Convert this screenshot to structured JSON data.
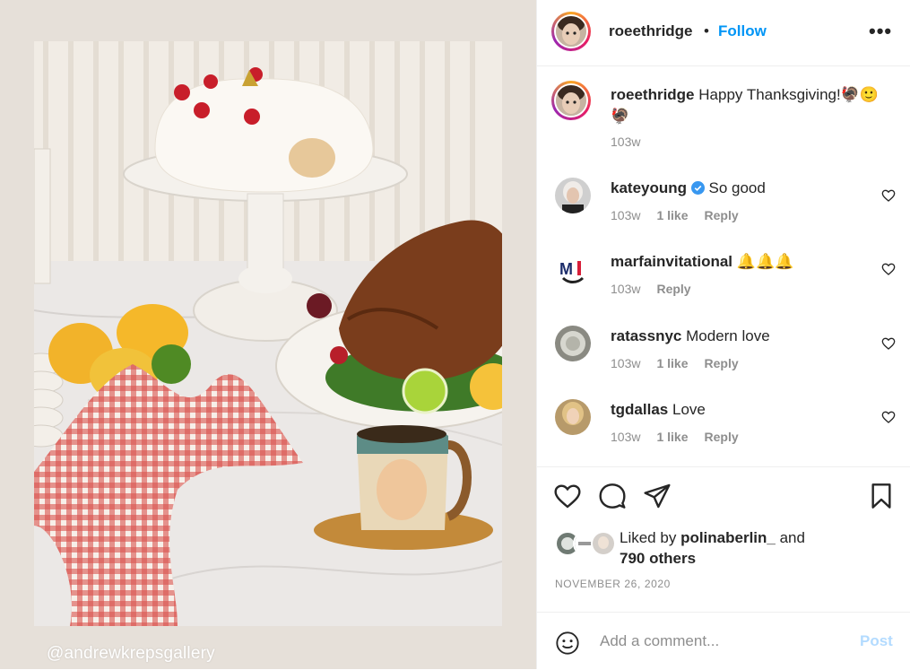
{
  "photo": {
    "watermark": "@andrewkrepsgallery",
    "alt_subject": "thanksgiving-table-photo"
  },
  "header": {
    "username": "roeethridge",
    "separator": "•",
    "follow_label": "Follow",
    "more_label": "•••"
  },
  "caption": {
    "username": "roeethridge",
    "text": "Happy Thanksgiving!🦃🙂🦃",
    "age": "103w"
  },
  "comments": [
    {
      "username": "kateyoung",
      "verified": true,
      "text": "So good",
      "age": "103w",
      "likes": "1 like",
      "reply": "Reply"
    },
    {
      "username": "marfainvitational",
      "verified": false,
      "text": "🔔🔔🔔",
      "age": "103w",
      "likes": "",
      "reply": "Reply"
    },
    {
      "username": "ratassnyc",
      "verified": false,
      "text": "Modern love",
      "age": "103w",
      "likes": "1 like",
      "reply": "Reply"
    },
    {
      "username": "tgdallas",
      "verified": false,
      "text": "Love",
      "age": "103w",
      "likes": "1 like",
      "reply": "Reply"
    }
  ],
  "actions": {
    "like_icon": "heart-outline-icon",
    "comment_icon": "speech-bubble-icon",
    "share_icon": "paper-plane-icon",
    "save_icon": "bookmark-icon"
  },
  "likes": {
    "prefix": "Liked by",
    "user": "polinaberlin_",
    "and": "and",
    "others": "790 others"
  },
  "date": "NOVEMBER 26, 2020",
  "comment_box": {
    "placeholder": "Add a comment...",
    "post_label": "Post",
    "emoji_icon": "smiley-icon"
  },
  "colors": {
    "accent": "#0095f6",
    "post_disabled": "#b3dbff",
    "muted": "#8e8e8e",
    "text": "#262626"
  }
}
